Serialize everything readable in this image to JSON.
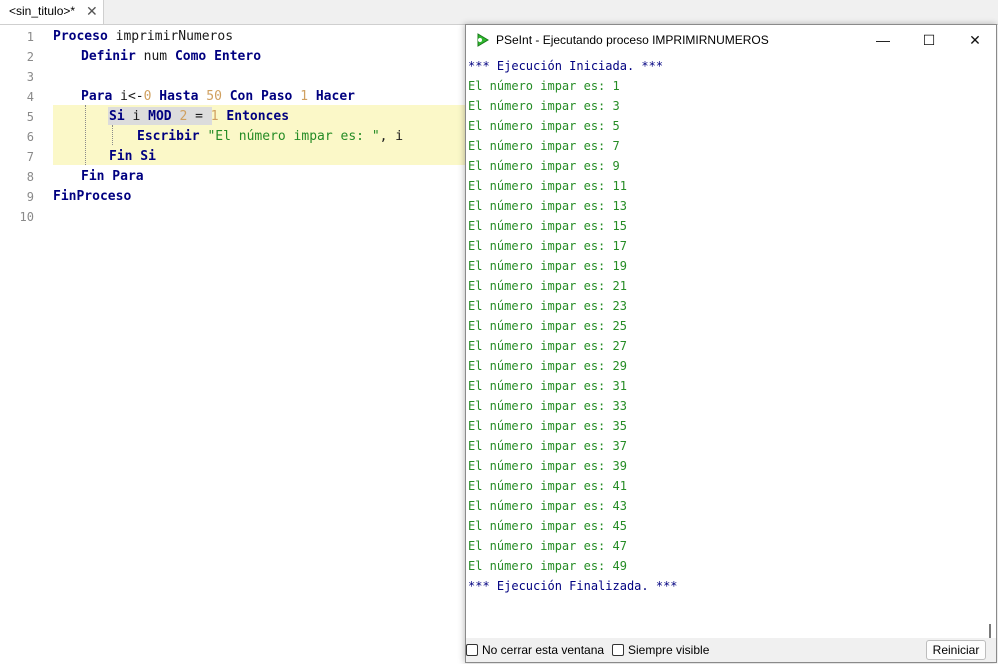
{
  "tab": {
    "title": "<sin_titulo>*",
    "close_glyph": "✕"
  },
  "editor": {
    "line_numbers": [
      "1",
      "2",
      "3",
      "4",
      "5",
      "6",
      "7",
      "8",
      "9",
      "10"
    ],
    "lines": {
      "l1": {
        "kw": "Proceso",
        "name": "imprimirNumeros"
      },
      "l2": {
        "kw": "Definir",
        "var": "num",
        "kw2": "Como Entero"
      },
      "l4": {
        "kw": "Para",
        "var": "i<-",
        "start": "0",
        "kw2": "Hasta",
        "end": "50",
        "kw3": "Con Paso",
        "step": "1",
        "kw4": "Hacer"
      },
      "l5": {
        "kw": "Si",
        "var": "i",
        "op": "MOD",
        "n": "2",
        "eq": "=",
        "one": "1",
        "kw2": "Entonces"
      },
      "l6": {
        "kw": "Escribir",
        "str": "\"El número impar es: \"",
        "rest": ", i"
      },
      "l7": {
        "kw": "Fin Si"
      },
      "l8": {
        "kw": "Fin Para"
      },
      "l9": {
        "kw": "FinProceso"
      }
    }
  },
  "run_window": {
    "title": "PSeInt - Ejecutando proceso IMPRIMIRNUMEROS",
    "icon": "pseint-app-icon",
    "controls": {
      "minimize": "—",
      "maximize": "☐",
      "close": "✕"
    },
    "console": {
      "start": "*** Ejecución Iniciada. ***",
      "output": [
        "El número impar es: 1",
        "El número impar es: 3",
        "El número impar es: 5",
        "El número impar es: 7",
        "El número impar es: 9",
        "El número impar es: 11",
        "El número impar es: 13",
        "El número impar es: 15",
        "El número impar es: 17",
        "El número impar es: 19",
        "El número impar es: 21",
        "El número impar es: 23",
        "El número impar es: 25",
        "El número impar es: 27",
        "El número impar es: 29",
        "El número impar es: 31",
        "El número impar es: 33",
        "El número impar es: 35",
        "El número impar es: 37",
        "El número impar es: 39",
        "El número impar es: 41",
        "El número impar es: 43",
        "El número impar es: 45",
        "El número impar es: 47",
        "El número impar es: 49"
      ],
      "end": "*** Ejecución Finalizada. ***"
    },
    "footer": {
      "keep_open": {
        "label": "No cerrar esta ventana",
        "checked": false
      },
      "always_visible": {
        "label": "Siempre visible",
        "checked": false
      },
      "restart_label": "Reiniciar"
    }
  },
  "colors": {
    "keyword": "#000080",
    "string": "#258c25",
    "number": "#d0a060",
    "highlight": "#fbf8c8",
    "console_output": "#258c25",
    "console_info": "#000080"
  }
}
